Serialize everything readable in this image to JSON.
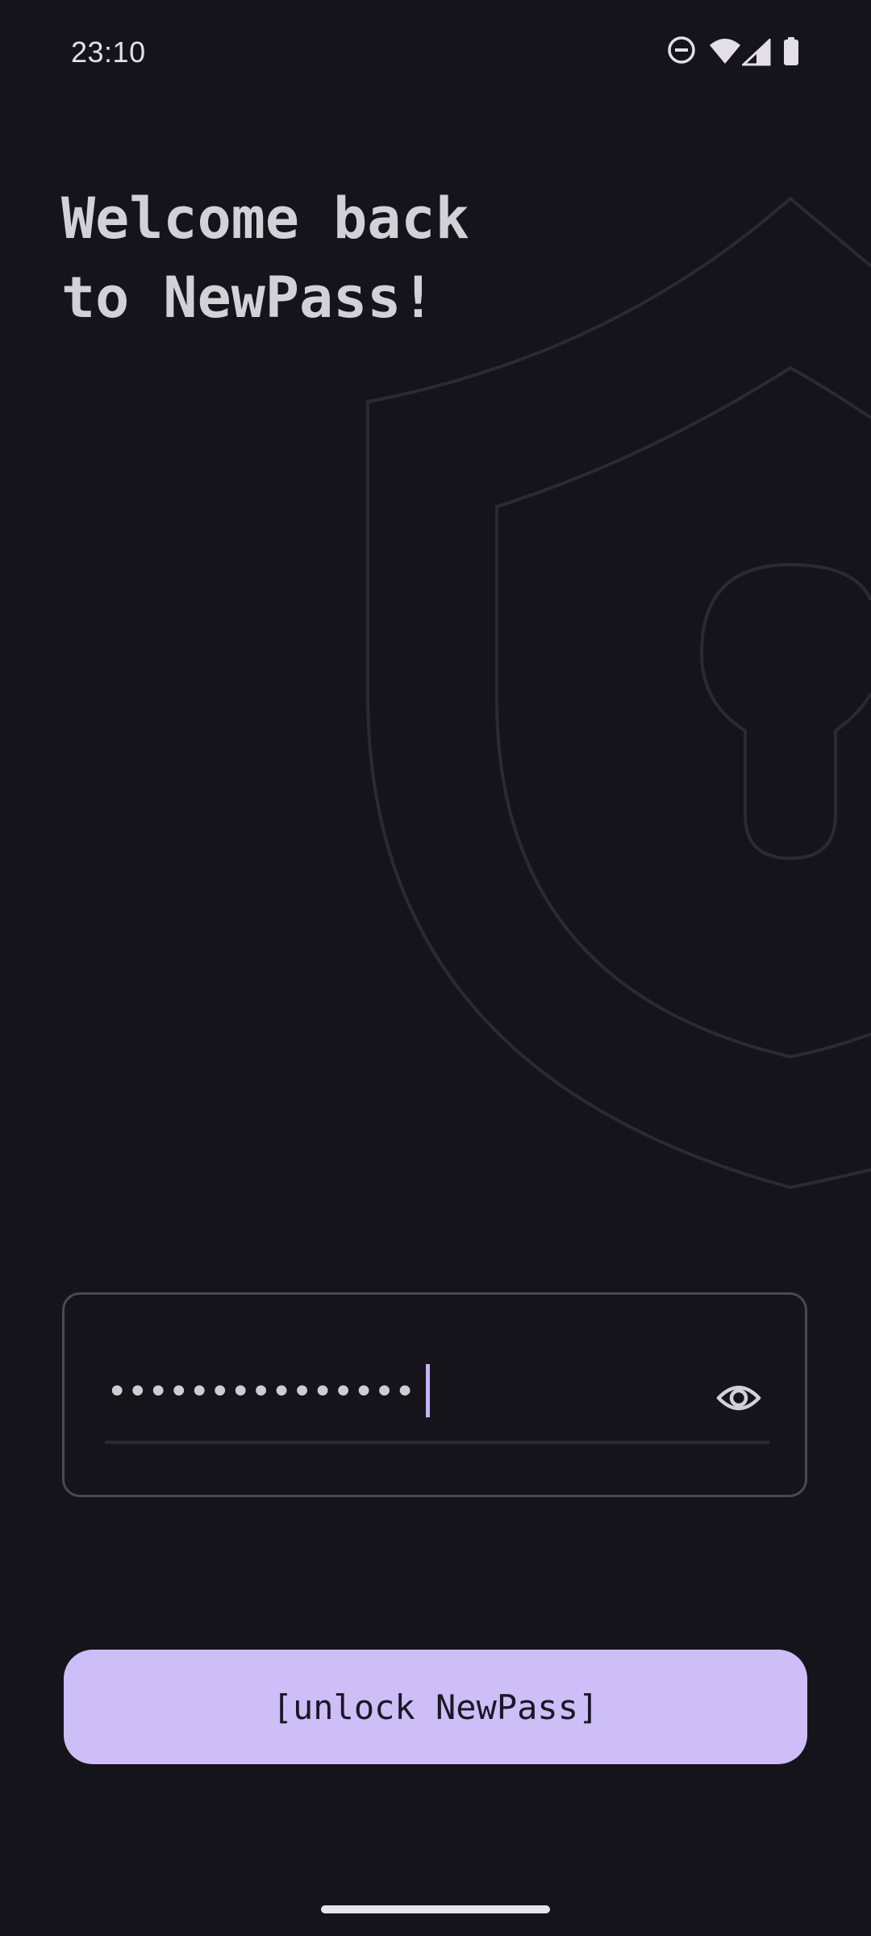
{
  "status_bar": {
    "time": "23:10",
    "icons": [
      "do-not-disturb-icon",
      "wifi-icon",
      "cellular-signal-icon",
      "battery-icon"
    ]
  },
  "welcome": {
    "line1": "Welcome back",
    "line2": "to NewPass!"
  },
  "password_field": {
    "masked_value": "•••••••••••••••",
    "toggle_icon": "eye-icon"
  },
  "unlock_button": {
    "label": "[unlock NewPass]"
  },
  "colors": {
    "background": "#16141b",
    "accent": "#cdbef7",
    "caret": "#c5b4f4",
    "text": "#d3d1d8"
  }
}
